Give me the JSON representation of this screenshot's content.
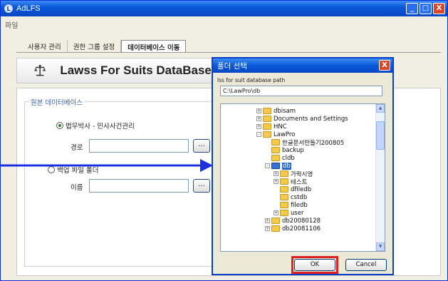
{
  "window": {
    "title": "AdLFS",
    "min": "_",
    "max": "□",
    "close": "X"
  },
  "menu": {
    "file": "파일"
  },
  "tabs": [
    "사용자 관리",
    "권한 그룹 설정",
    "데이터베이스 이동"
  ],
  "header": {
    "title": "Lawss For Suits DataBase T"
  },
  "group": {
    "title": "원본 데이터베이스",
    "option1": "법무박사 - 민사사건관리",
    "path_label": "경로",
    "option2": "백업 파일 폴더",
    "name_label": "이름",
    "browse": "..."
  },
  "dialog": {
    "title": "폴더 선택",
    "close": "X",
    "description": "lss for suit database path",
    "path": "C:\\LawPro\\db",
    "tree": [
      "dbisam",
      "Documents and Settings",
      "HNC",
      "LawPro",
      "한글문서만들기200805",
      "backup",
      "cldb",
      "db",
      "가락시영",
      "테스트",
      "dfiledb",
      "cstdb",
      "filedb",
      "user",
      "db20080128",
      "db20081106"
    ],
    "ok": "OK",
    "cancel": "Cancel"
  }
}
